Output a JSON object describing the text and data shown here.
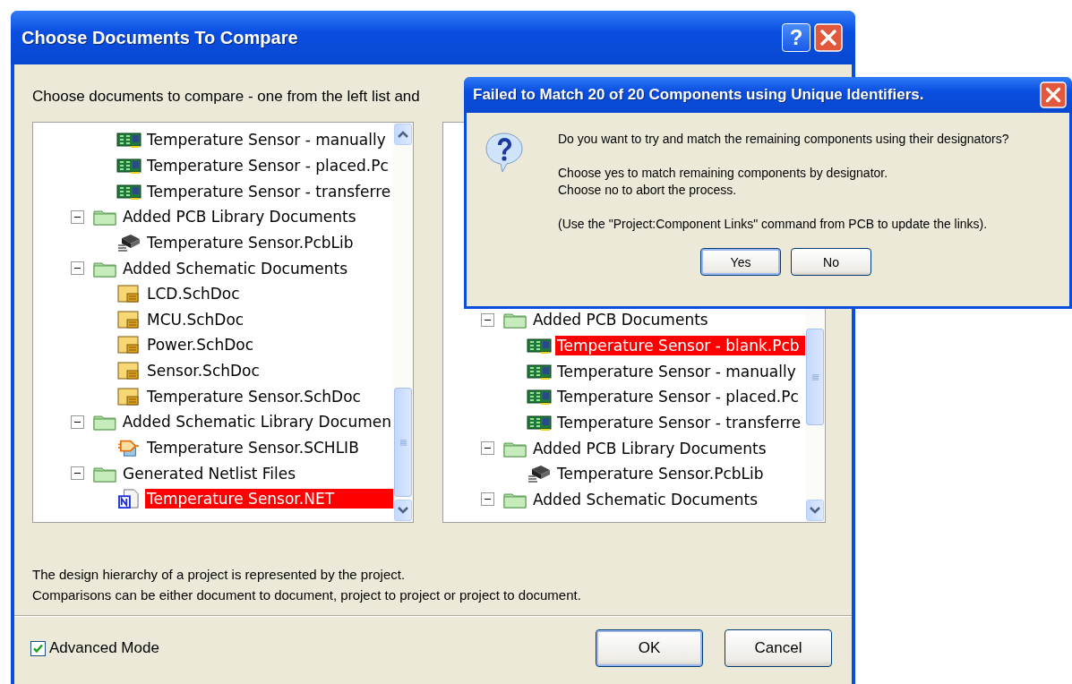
{
  "main_window": {
    "title": "Choose Documents To Compare",
    "help_button": "?",
    "intro": "Choose documents to compare - one from the left list and",
    "left_tree": {
      "nodes": [
        {
          "kind": "pcb",
          "label": "Temperature Sensor - manually",
          "selected": false
        },
        {
          "kind": "pcb",
          "label": "Temperature Sensor - placed.Pc",
          "selected": false
        },
        {
          "kind": "pcb",
          "label": "Temperature Sensor - transferre",
          "selected": false
        },
        {
          "kind": "folder",
          "label": "Added PCB Library Documents",
          "expanded": true,
          "children": [
            {
              "kind": "pcblib",
              "label": "Temperature Sensor.PcbLib",
              "selected": false
            }
          ]
        },
        {
          "kind": "folder",
          "label": "Added Schematic Documents",
          "expanded": true,
          "children": [
            {
              "kind": "schdoc",
              "label": "LCD.SchDoc",
              "selected": false
            },
            {
              "kind": "schdoc",
              "label": "MCU.SchDoc",
              "selected": false
            },
            {
              "kind": "schdoc",
              "label": "Power.SchDoc",
              "selected": false
            },
            {
              "kind": "schdoc",
              "label": "Sensor.SchDoc",
              "selected": false
            },
            {
              "kind": "schdoc",
              "label": "Temperature Sensor.SchDoc",
              "selected": false
            }
          ]
        },
        {
          "kind": "folder",
          "label": "Added Schematic Library Documen",
          "expanded": true,
          "children": [
            {
              "kind": "schlib",
              "label": "Temperature Sensor.SCHLIB",
              "selected": false
            }
          ]
        },
        {
          "kind": "folder",
          "label": "Generated Netlist Files",
          "expanded": true,
          "children": [
            {
              "kind": "net",
              "label": "Temperature Sensor.NET",
              "selected": true
            }
          ]
        }
      ]
    },
    "right_tree": {
      "nodes": [
        {
          "kind": "folder",
          "label": "Added PCB Documents",
          "expanded": true,
          "children": [
            {
              "kind": "pcb",
              "label": "Temperature Sensor - blank.Pcb",
              "selected": true
            },
            {
              "kind": "pcb",
              "label": "Temperature Sensor - manually",
              "selected": false
            },
            {
              "kind": "pcb",
              "label": "Temperature Sensor - placed.Pc",
              "selected": false
            },
            {
              "kind": "pcb",
              "label": "Temperature Sensor - transferre",
              "selected": false
            }
          ]
        },
        {
          "kind": "folder",
          "label": "Added PCB Library Documents",
          "expanded": true,
          "children": [
            {
              "kind": "pcblib",
              "label": "Temperature Sensor.PcbLib",
              "selected": false
            }
          ]
        },
        {
          "kind": "folder",
          "label": "Added Schematic Documents",
          "expanded": true
        }
      ]
    },
    "notes": [
      "The design hierarchy of a project is represented by the project.",
      "Comparisons can be either document to document, project to project or project to document."
    ],
    "advanced_mode": {
      "label": "Advanced Mode",
      "checked": true
    },
    "buttons": [
      {
        "label": "OK",
        "default": true
      },
      {
        "label": "Cancel",
        "default": false
      }
    ]
  },
  "message_box": {
    "title": "Failed to Match 20 of 20 Components using Unique Identifiers.",
    "paragraphs": [
      [
        "Do you want to try and match the remaining components using their designators?"
      ],
      [
        "Choose yes to match remaining components by designator.",
        "Choose no to abort the process."
      ],
      [
        "(Use the \"Project:Component Links\" command from PCB to update the links)."
      ]
    ],
    "buttons": [
      {
        "label": "Yes",
        "default": true
      },
      {
        "label": "No",
        "default": false
      }
    ]
  }
}
